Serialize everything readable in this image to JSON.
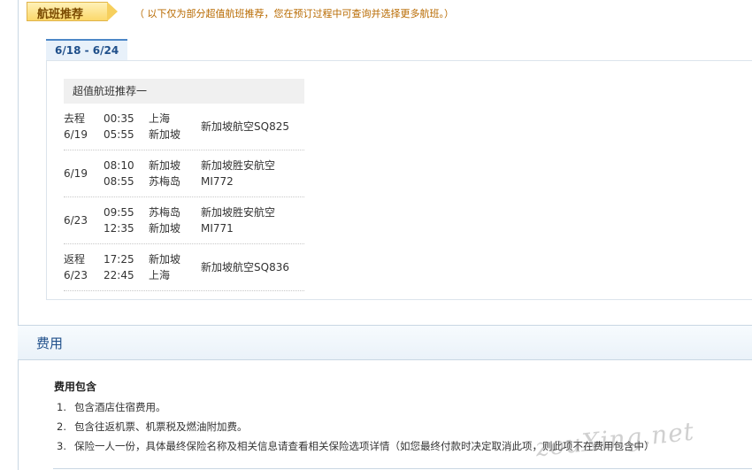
{
  "recommend": {
    "tab_label": "航班推荐",
    "note": "（ 以下仅为部分超值航班推荐，您在预订过程中可查询并选择更多航班。）"
  },
  "date_range": "6/18 - 6/24",
  "section_title": "超值航班推荐一",
  "flights": [
    {
      "date_line1": "去程",
      "date_line2": "6/19",
      "dep_time": "00:35",
      "arr_time": "05:55",
      "from": "上海",
      "to": "新加坡",
      "airline_line1": "新加坡航空SQ825",
      "airline_line2": ""
    },
    {
      "date_line1": "",
      "date_line2": "6/19",
      "dep_time": "08:10",
      "arr_time": "08:55",
      "from": "新加坡",
      "to": "苏梅岛",
      "airline_line1": "新加坡胜安航空",
      "airline_line2": "MI772"
    },
    {
      "date_line1": "",
      "date_line2": "6/23",
      "dep_time": "09:55",
      "arr_time": "12:35",
      "from": "苏梅岛",
      "to": "新加坡",
      "airline_line1": "新加坡胜安航空",
      "airline_line2": "MI771"
    },
    {
      "date_line1": "返程",
      "date_line2": "6/23",
      "dep_time": "17:25",
      "arr_time": "22:45",
      "from": "新加坡",
      "to": "上海",
      "airline_line1": "新加坡航空SQ836",
      "airline_line2": ""
    }
  ],
  "fees": {
    "title": "费用",
    "subtitle": "费用包含",
    "items": [
      {
        "num": "1.",
        "text": "包含酒店住宿费用。"
      },
      {
        "num": "2.",
        "text": "包含往返机票、机票税及燃油附加费。"
      },
      {
        "num": "3.",
        "text": "保险一人一份，具体最终保险名称及相关信息请查看相关保险选项详情（如您最终付款时决定取消此项，则此项不在费用包含中）"
      }
    ]
  },
  "watermark": "zouXing.net"
}
